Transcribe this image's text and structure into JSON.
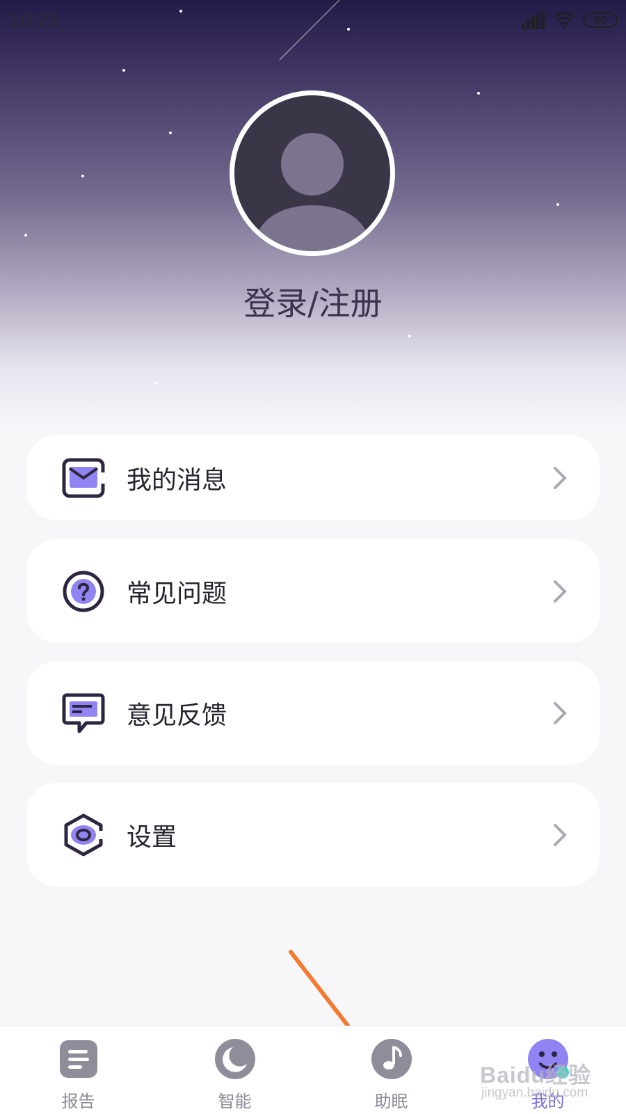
{
  "status_bar": {
    "time": "10:23",
    "battery": "80"
  },
  "profile": {
    "login_label": "登录/注册"
  },
  "menu": [
    {
      "label": "我的消息",
      "icon": "mail-icon"
    },
    {
      "label": "常见问题",
      "icon": "question-icon"
    },
    {
      "label": "意见反馈",
      "icon": "feedback-icon"
    },
    {
      "label": "设置",
      "icon": "settings-icon"
    }
  ],
  "bottom_nav": [
    {
      "label": "报告",
      "icon": "report-icon",
      "active": false
    },
    {
      "label": "智能",
      "icon": "moon-icon",
      "active": false
    },
    {
      "label": "助眠",
      "icon": "music-note-icon",
      "active": false
    },
    {
      "label": "我的",
      "icon": "profile-icon",
      "active": true
    }
  ],
  "watermark": {
    "text": "Baidu经验",
    "url": "jingyan.baidu.com"
  },
  "colors": {
    "accent": "#7a6ecf",
    "icon_dark": "#2d2540",
    "icon_fill": "#8f84f2",
    "arrow": "#f37a2f"
  }
}
